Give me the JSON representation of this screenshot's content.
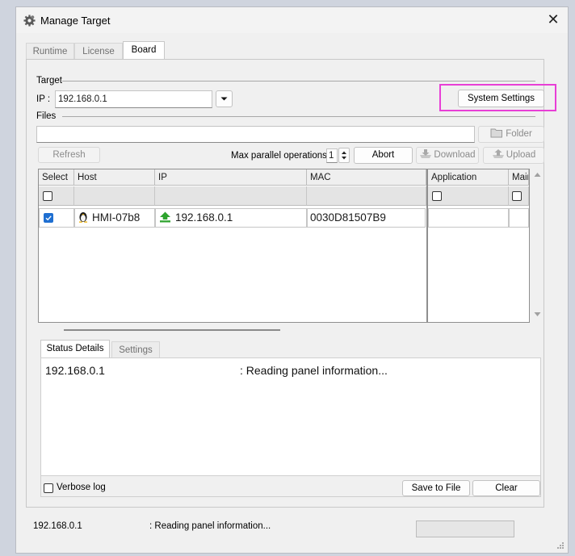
{
  "window": {
    "title": "Manage Target",
    "close_glyph": "✕",
    "icon": "gear-icon"
  },
  "tabs": [
    {
      "label": "Runtime",
      "active": false
    },
    {
      "label": "License",
      "active": false
    },
    {
      "label": "Board",
      "active": true
    }
  ],
  "target": {
    "group_label": "Target",
    "ip_label": "IP :",
    "ip_value": "192.168.0.1",
    "system_settings_label": "System Settings"
  },
  "files": {
    "group_label": "Files",
    "path_value": "",
    "folder_label": "Folder"
  },
  "actions": {
    "refresh_label": "Refresh",
    "max_parallel_label": "Max parallel operations:",
    "max_parallel_value": "1",
    "abort_label": "Abort",
    "download_label": "Download",
    "upload_label": "Upload"
  },
  "grid": {
    "columns": [
      "Select",
      "Host",
      "IP",
      "MAC"
    ],
    "right_columns": [
      "Application",
      "Main"
    ],
    "rows": [
      {
        "selected": true,
        "host": "HMI-07b8",
        "ip": "192.168.0.1",
        "mac": "0030D81507B9",
        "host_icon": "linux-penguin-icon",
        "ip_icon": "upload-arrow-icon"
      }
    ]
  },
  "status": {
    "tabs": [
      {
        "label": "Status Details",
        "active": true
      },
      {
        "label": "Settings",
        "active": false
      }
    ],
    "log_ip": "192.168.0.1",
    "log_message": ": Reading panel information...",
    "verbose_label": "Verbose log",
    "save_label": "Save to File",
    "clear_label": "Clear"
  },
  "statusbar": {
    "ip": "192.168.0.1",
    "message": ": Reading panel information..."
  },
  "colors": {
    "highlight": "#e83fd6",
    "checkbox_checked": "#1f6fd1"
  }
}
